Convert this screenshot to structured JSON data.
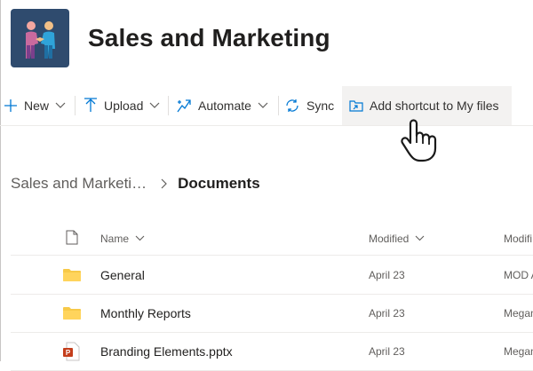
{
  "site": {
    "title": "Sales and Marketing"
  },
  "command_bar": {
    "new_label": "New",
    "upload_label": "Upload",
    "automate_label": "Automate",
    "sync_label": "Sync",
    "add_shortcut_label": "Add shortcut to My files"
  },
  "breadcrumb": {
    "parent": "Sales and Marketi…",
    "current": "Documents"
  },
  "list": {
    "columns": {
      "name": "Name",
      "modified": "Modified",
      "modified_by": "Modifi"
    },
    "rows": [
      {
        "name": "General",
        "modified": "April 23",
        "modified_by": "MOD A",
        "icon": "folder-icon"
      },
      {
        "name": "Monthly Reports",
        "modified": "April 23",
        "modified_by": "Megan",
        "icon": "folder-icon"
      },
      {
        "name": "Branding Elements.pptx",
        "modified": "April 23",
        "modified_by": "Megan",
        "icon": "powerpoint-file-icon"
      }
    ]
  },
  "colors": {
    "accent": "#0078d4",
    "folder": "#f7c948",
    "powerpoint": "#c43e1c",
    "logo_bg": "#2f4b6e"
  }
}
